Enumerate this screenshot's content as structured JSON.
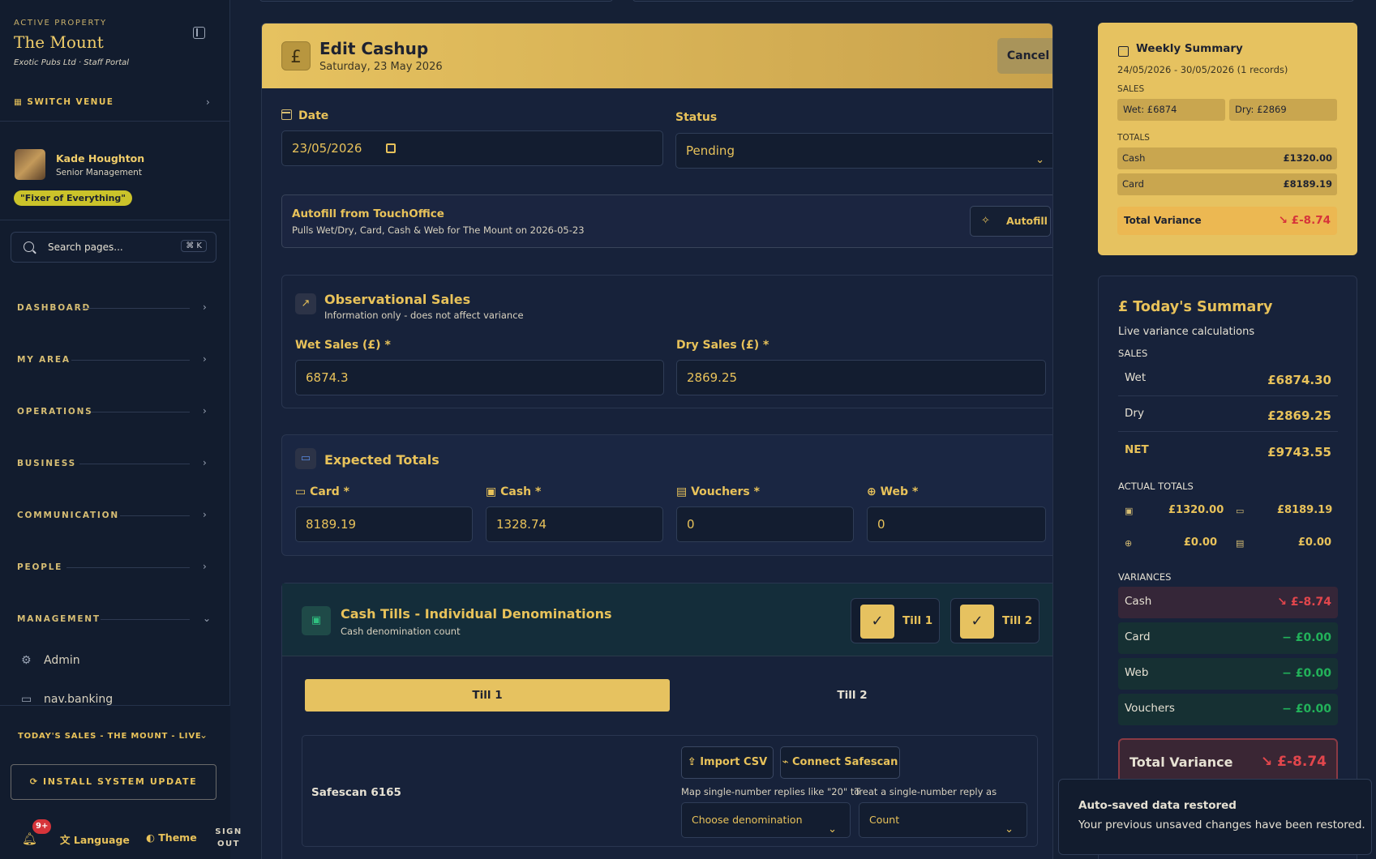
{
  "sidebar": {
    "active_property_label": "ACTIVE PROPERTY",
    "venue_name": "The Mount",
    "venue_sub": "Exotic Pubs Ltd · Staff Portal",
    "switch_venue": "SWITCH VENUE",
    "user": {
      "name": "Kade Houghton",
      "role": "Senior Management",
      "badge": "\"Fixer of Everything\""
    },
    "search": {
      "placeholder": "Search pages...",
      "shortcut": "⌘ K"
    },
    "nav": [
      "DASHBOARD",
      "MY AREA",
      "OPERATIONS",
      "BUSINESS",
      "COMMUNICATION",
      "PEOPLE",
      "MANAGEMENT"
    ],
    "management_items": [
      "Admin",
      "nav.banking"
    ],
    "today_sales": "TODAY'S SALES - THE MOUNT - LIVE",
    "install_update": "INSTALL SYSTEM UPDATE",
    "notif_count": "9+",
    "language": "Language",
    "theme": "Theme",
    "sign_out": "SIGN OUT"
  },
  "main": {
    "title": "Edit Cashup",
    "date_display": "Saturday, 23 May 2026",
    "cancel": "Cancel",
    "date_label": "Date",
    "date_value": "23/05/2026",
    "status_label": "Status",
    "status_value": "Pending",
    "autofill": {
      "title": "Autofill from TouchOffice",
      "sub": "Pulls Wet/Dry, Card, Cash & Web for The Mount on 2026-05-23",
      "button": "Autofill"
    },
    "observational": {
      "title": "Observational Sales",
      "sub": "Information only - does not affect variance",
      "wet_label": "Wet Sales (£) *",
      "wet_value": "6874.3",
      "dry_label": "Dry Sales (£) *",
      "dry_value": "2869.25"
    },
    "expected": {
      "title": "Expected Totals",
      "fields": [
        {
          "label": "Card *",
          "value": "8189.19"
        },
        {
          "label": "Cash *",
          "value": "1328.74"
        },
        {
          "label": "Vouchers *",
          "value": "0"
        },
        {
          "label": "Web *",
          "value": "0"
        }
      ]
    },
    "tills": {
      "title": "Cash Tills - Individual Denominations",
      "sub": "Cash denomination count",
      "toggles": [
        "Till 1",
        "Till 2"
      ],
      "tabs": [
        "Till 1",
        "Till 2"
      ],
      "safescan_label": "Safescan 6165",
      "import_csv": "Import CSV",
      "connect_safescan": "Connect Safescan",
      "map_label": "Map single-number replies like \"20\" to",
      "treat_label": "Treat a single-number reply as",
      "map_value": "Choose denomination",
      "treat_value": "Count"
    }
  },
  "weekly": {
    "title": "Weekly Summary",
    "range": "24/05/2026 - 30/05/2026 (1 records)",
    "sales_label": "SALES",
    "wet": "Wet: £6874",
    "dry": "Dry: £2869",
    "totals_label": "TOTALS",
    "cash_label": "Cash",
    "cash_value": "£1320.00",
    "card_label": "Card",
    "card_value": "£8189.19",
    "variance_label": "Total Variance",
    "variance_value": "↘ £-8.74"
  },
  "today": {
    "title": "Today's Summary",
    "sub": "Live variance calculations",
    "sales_label": "SALES",
    "wet_label": "Wet",
    "wet_value": "£6874.30",
    "dry_label": "Dry",
    "dry_value": "£2869.25",
    "net_label": "NET",
    "net_value": "£9743.55",
    "actual_label": "ACTUAL TOTALS",
    "actual_cash": "£1320.00",
    "actual_card": "£8189.19",
    "actual_web": "£0.00",
    "actual_vouchers": "£0.00",
    "variances_label": "VARIANCES",
    "variances": [
      {
        "label": "Cash",
        "value": "↘ £-8.74"
      },
      {
        "label": "Card",
        "value": "− £0.00"
      },
      {
        "label": "Web",
        "value": "− £0.00"
      },
      {
        "label": "Vouchers",
        "value": "− £0.00"
      }
    ],
    "total_variance_label": "Total Variance",
    "total_variance_value": "↘ £-8.74"
  },
  "toast": {
    "title": "Auto-saved data restored",
    "message": "Your previous unsaved changes have been restored."
  },
  "colors": {
    "accent": "#e6c260",
    "background": "#152035",
    "negative": "#e2464c",
    "positive": "#22b25a"
  }
}
